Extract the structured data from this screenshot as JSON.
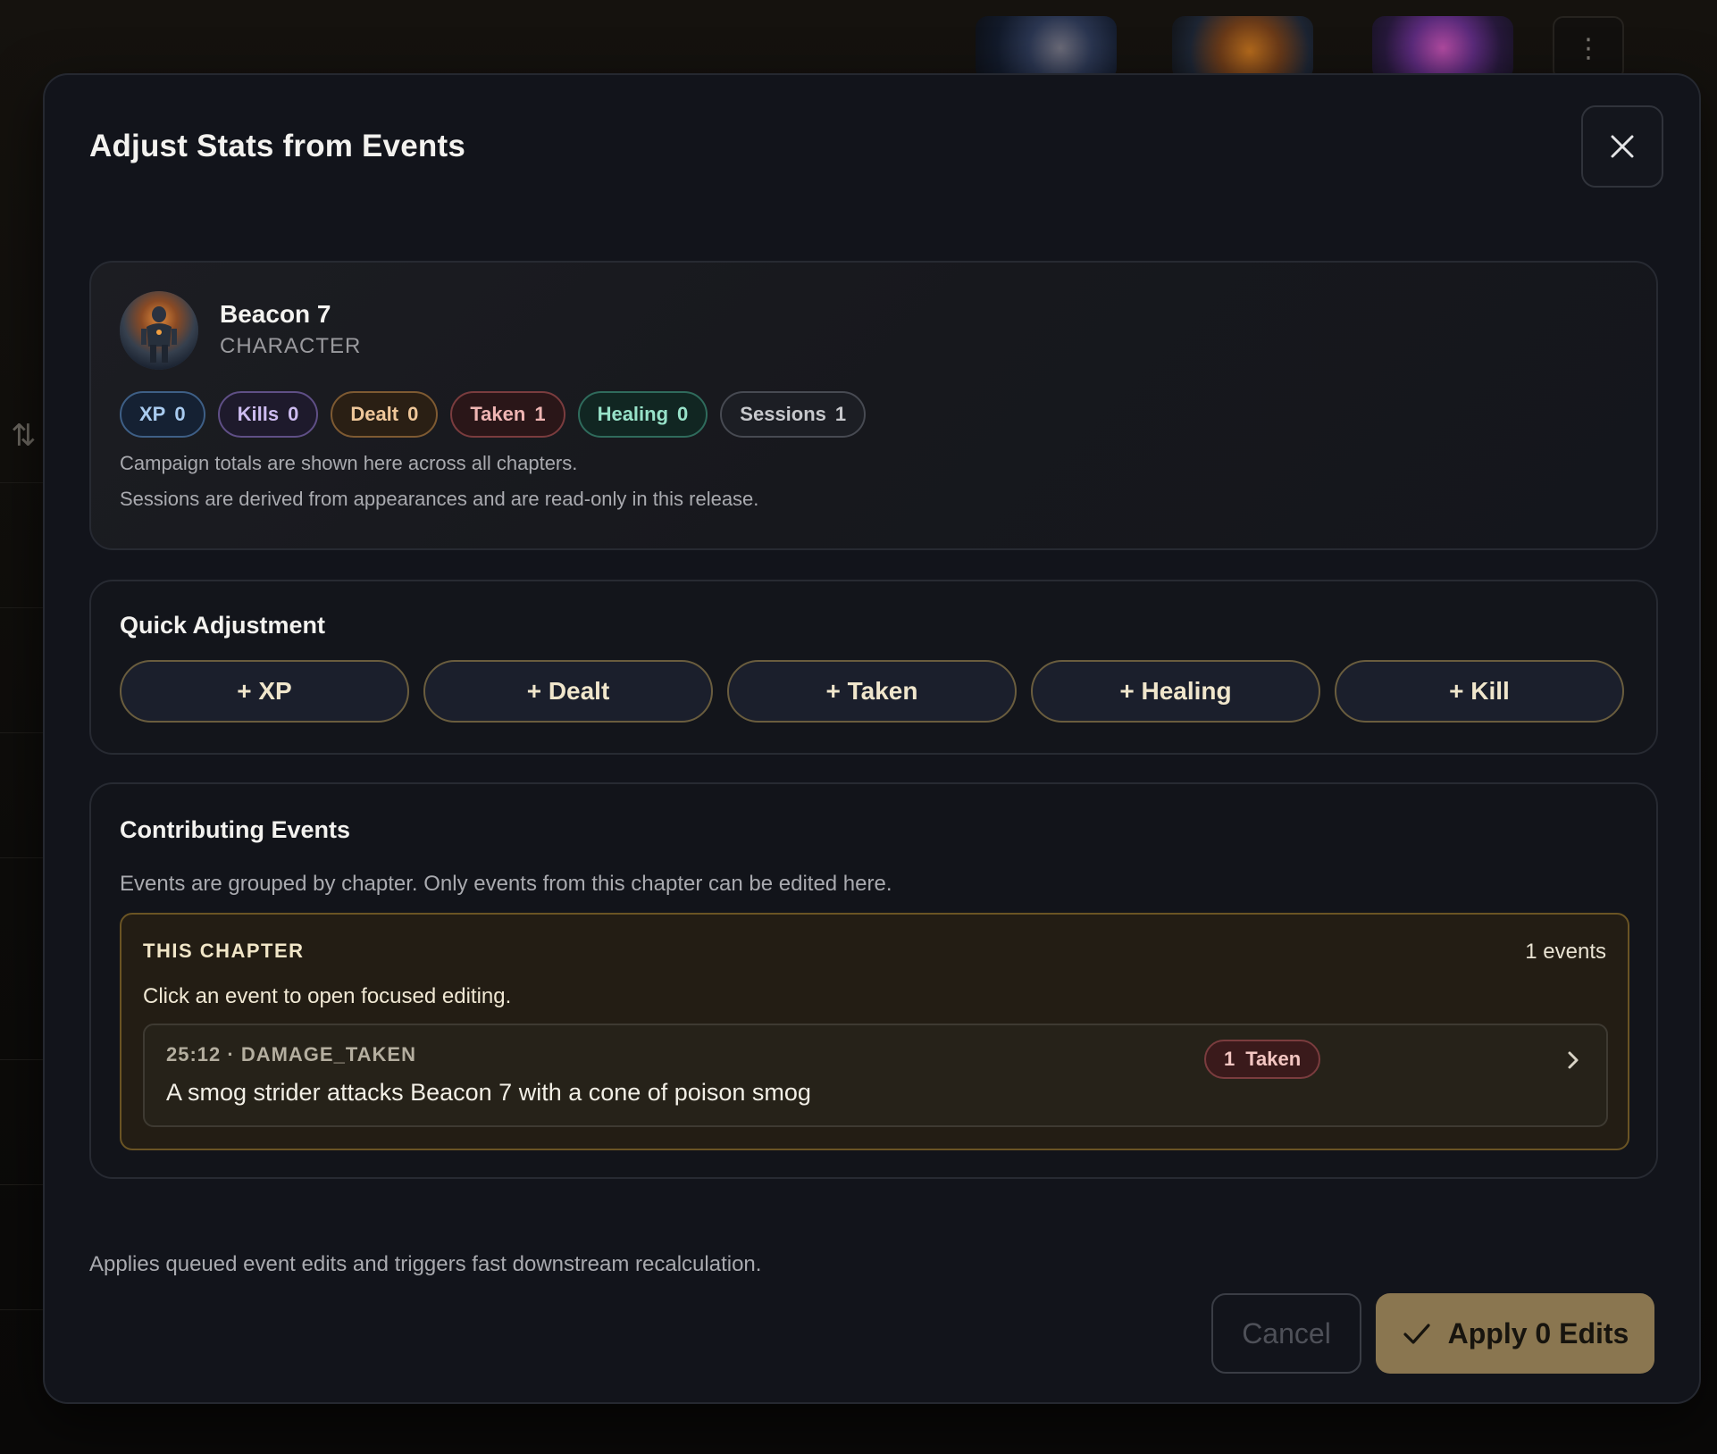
{
  "modal": {
    "title": "Adjust Stats from Events",
    "close_icon": "close-icon"
  },
  "character": {
    "name": "Beacon 7",
    "type": "CHARACTER",
    "stats": [
      {
        "key": "xp",
        "label": "XP",
        "value": "0",
        "color": "#a9cbef"
      },
      {
        "key": "kills",
        "label": "Kills",
        "value": "0",
        "color": "#cdbcf0"
      },
      {
        "key": "dealt",
        "label": "Dealt",
        "value": "0",
        "color": "#efc79a"
      },
      {
        "key": "taken",
        "label": "Taken",
        "value": "1",
        "color": "#efb5b3"
      },
      {
        "key": "healing",
        "label": "Healing",
        "value": "0",
        "color": "#98e2c9"
      },
      {
        "key": "sessions",
        "label": "Sessions",
        "value": "1",
        "color": "#c7c8cc"
      }
    ],
    "notes": [
      "Campaign totals are shown here across all chapters.",
      "Sessions are derived from appearances and are read-only in this release."
    ]
  },
  "quick_adjustment": {
    "title": "Quick Adjustment",
    "buttons": [
      "+ XP",
      "+ Dealt",
      "+ Taken",
      "+ Healing",
      "+ Kill"
    ]
  },
  "contributing_events": {
    "title": "Contributing Events",
    "description": "Events are grouped by chapter. Only events from this chapter can be edited here.",
    "chapter": {
      "label": "THIS CHAPTER",
      "count": "1 events",
      "hint": "Click an event to open focused editing.",
      "events": [
        {
          "meta": "25:12 · DAMAGE_TAKEN",
          "text": "A smog strider attacks Beacon 7 with a cone of poison smog",
          "badge_value": "1",
          "badge_label": "Taken"
        }
      ]
    }
  },
  "footer": {
    "note": "Applies queued event edits and triggers fast downstream recalculation.",
    "cancel_label": "Cancel",
    "apply_label": "Apply 0 Edits"
  },
  "colors": {
    "accent": "#8a7650",
    "modal_bg": "#12141b"
  }
}
